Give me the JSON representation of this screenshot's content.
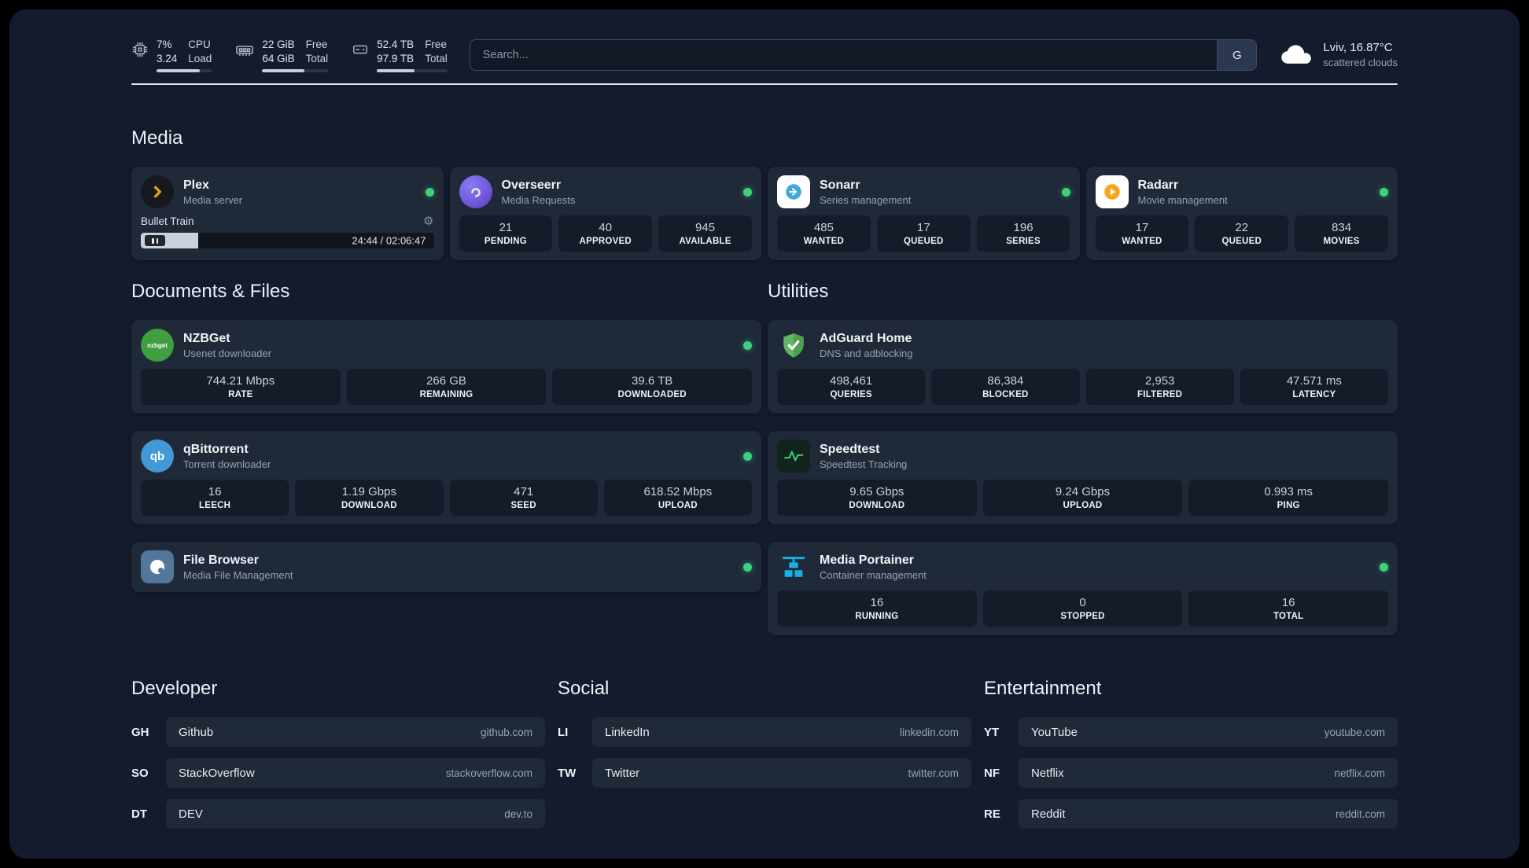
{
  "colors": {
    "status_online": "#3ed17b"
  },
  "topbar": {
    "cpu": {
      "value_top": "7%",
      "value_bottom": "3.24",
      "label_top": "CPU",
      "label_bottom": "Load",
      "bar_percent": 78
    },
    "memory": {
      "value_top": "22 GiB",
      "value_bottom": "64 GiB",
      "label_top": "Free",
      "label_bottom": "Total",
      "bar_percent": 64
    },
    "disk": {
      "value_top": "52.4 TB",
      "value_bottom": "97.9 TB",
      "label_top": "Free",
      "label_bottom": "Total",
      "bar_percent": 53
    },
    "search": {
      "placeholder": "Search...",
      "button_label": "G"
    },
    "weather": {
      "line1": "Lviv, 16.87°C",
      "line2": "scattered clouds"
    }
  },
  "sections": {
    "media": "Media",
    "documents": "Documents & Files",
    "utilities": "Utilities",
    "developer": "Developer",
    "social": "Social",
    "entertainment": "Entertainment"
  },
  "apps": {
    "plex": {
      "name": "Plex",
      "subtitle": "Media server",
      "now_playing_title": "Bullet Train",
      "time": "24:44 / 02:06:47",
      "progress_percent": 19.5
    },
    "overseerr": {
      "name": "Overseerr",
      "subtitle": "Media Requests",
      "stats": [
        {
          "value": "21",
          "label": "PENDING"
        },
        {
          "value": "40",
          "label": "APPROVED"
        },
        {
          "value": "945",
          "label": "AVAILABLE"
        }
      ]
    },
    "sonarr": {
      "name": "Sonarr",
      "subtitle": "Series management",
      "stats": [
        {
          "value": "485",
          "label": "WANTED"
        },
        {
          "value": "17",
          "label": "QUEUED"
        },
        {
          "value": "196",
          "label": "SERIES"
        }
      ]
    },
    "radarr": {
      "name": "Radarr",
      "subtitle": "Movie management",
      "stats": [
        {
          "value": "17",
          "label": "WANTED"
        },
        {
          "value": "22",
          "label": "QUEUED"
        },
        {
          "value": "834",
          "label": "MOVIES"
        }
      ]
    },
    "nzbget": {
      "name": "NZBGet",
      "subtitle": "Usenet downloader",
      "icon_text": "nzbget",
      "stats": [
        {
          "value": "744.21 Mbps",
          "label": "RATE"
        },
        {
          "value": "266 GB",
          "label": "REMAINING"
        },
        {
          "value": "39.6 TB",
          "label": "DOWNLOADED"
        }
      ]
    },
    "qbittorrent": {
      "name": "qBittorrent",
      "subtitle": "Torrent downloader",
      "icon_text": "qb",
      "stats": [
        {
          "value": "16",
          "label": "LEECH"
        },
        {
          "value": "1.19 Gbps",
          "label": "DOWNLOAD"
        },
        {
          "value": "471",
          "label": "SEED"
        },
        {
          "value": "618.52 Mbps",
          "label": "UPLOAD"
        }
      ]
    },
    "filebrowser": {
      "name": "File Browser",
      "subtitle": "Media File Management"
    },
    "adguard": {
      "name": "AdGuard Home",
      "subtitle": "DNS and adblocking",
      "stats": [
        {
          "value": "498,461",
          "label": "QUERIES"
        },
        {
          "value": "86,384",
          "label": "BLOCKED"
        },
        {
          "value": "2,953",
          "label": "FILTERED"
        },
        {
          "value": "47.571 ms",
          "label": "LATENCY"
        }
      ]
    },
    "speedtest": {
      "name": "Speedtest",
      "subtitle": "Speedtest Tracking",
      "stats": [
        {
          "value": "9.65 Gbps",
          "label": "DOWNLOAD"
        },
        {
          "value": "9.24 Gbps",
          "label": "UPLOAD"
        },
        {
          "value": "0.993 ms",
          "label": "PING"
        }
      ]
    },
    "portainer": {
      "name": "Media Portainer",
      "subtitle": "Container management",
      "stats": [
        {
          "value": "16",
          "label": "RUNNING"
        },
        {
          "value": "0",
          "label": "STOPPED"
        },
        {
          "value": "16",
          "label": "TOTAL"
        }
      ]
    }
  },
  "links": {
    "developer": [
      {
        "abbr": "GH",
        "name": "Github",
        "domain": "github.com"
      },
      {
        "abbr": "SO",
        "name": "StackOverflow",
        "domain": "stackoverflow.com"
      },
      {
        "abbr": "DT",
        "name": "DEV",
        "domain": "dev.to"
      }
    ],
    "social": [
      {
        "abbr": "LI",
        "name": "LinkedIn",
        "domain": "linkedin.com"
      },
      {
        "abbr": "TW",
        "name": "Twitter",
        "domain": "twitter.com"
      }
    ],
    "entertainment": [
      {
        "abbr": "YT",
        "name": "YouTube",
        "domain": "youtube.com"
      },
      {
        "abbr": "NF",
        "name": "Netflix",
        "domain": "netflix.com"
      },
      {
        "abbr": "RE",
        "name": "Reddit",
        "domain": "reddit.com"
      }
    ]
  }
}
